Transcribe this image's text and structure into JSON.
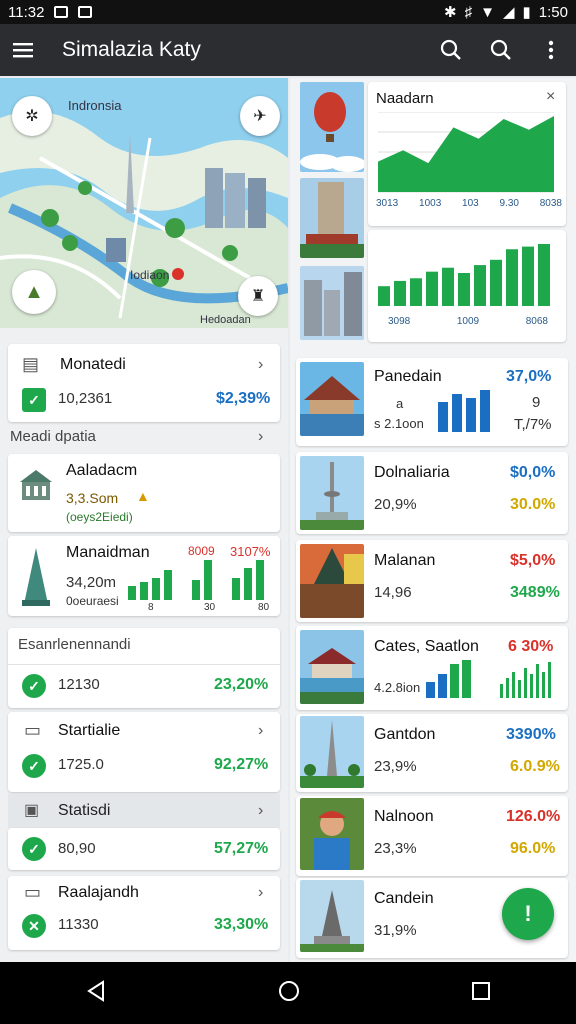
{
  "status": {
    "time": "11:32",
    "battery_time": "1:50"
  },
  "app": {
    "title": "Simalazia Katy"
  },
  "map": {
    "label": "Indronsia",
    "label2": "Iodiaon",
    "label3": "Hedoadan"
  },
  "left": {
    "card1": {
      "name": "Monatedi",
      "value": "10,2361",
      "pct": "$2,39%"
    },
    "section1": "Meadi dpatia",
    "card2": {
      "name": "Aaladacm",
      "value": "3,3.Som",
      "sub": "(oeys2Eiedi)"
    },
    "card3": {
      "name": "Manaidman",
      "value": "34,20m",
      "sub": "0oeuraesi",
      "pct1": "8009",
      "pct2": "3107%",
      "ticks": [
        "8",
        "30",
        "80"
      ]
    },
    "section2": "Esanrlenennandi",
    "row1": {
      "value": "12130",
      "pct": "23,20%"
    },
    "row2": {
      "name": "Startialie",
      "value": "1725.0",
      "pct": "92,27%"
    },
    "row3": {
      "name": "Statisdi",
      "value": "80,90",
      "pct": "57,27%"
    },
    "row4": {
      "name": "Raalajandh",
      "value": "11330",
      "pct": "33,30%"
    }
  },
  "right": {
    "chart1": {
      "title": "Naadarn",
      "ticks": [
        "3013",
        "1003",
        "103",
        "9.30",
        "8038"
      ],
      "values": [
        40,
        55,
        38,
        85,
        70,
        96,
        82,
        100
      ]
    },
    "chart2": {
      "ticks": [
        "3098",
        "1009",
        "8068"
      ],
      "values": [
        30,
        38,
        42,
        52,
        58,
        50,
        62,
        70,
        86,
        90,
        94
      ]
    },
    "item1": {
      "name": "Panedain",
      "left_small": "a",
      "left_red": "s 2.1oon",
      "pct": "37,0%",
      "val2": "9",
      "val3": "T,/7%"
    },
    "item2": {
      "name": "Dolnaliaria",
      "value": "20,9%",
      "pct": "$0,0%",
      "pct2": "30.0%"
    },
    "item3": {
      "name": "Malanan",
      "value": "14,96",
      "pct": "$5,0%",
      "pct2": "3489%"
    },
    "item4": {
      "name": "Cates, Saatlon",
      "value": "4.2.8ion",
      "pct": "6 30%"
    },
    "item5": {
      "name": "Gantdon",
      "value": "23,9%",
      "pct": "3390%",
      "pct2": "6.0.9%"
    },
    "item6": {
      "name": "Nalnoon",
      "value": "23,3%",
      "pct": "126.0%",
      "pct2": "96.0%"
    },
    "item7": {
      "name": "Candein",
      "value": "31,9%"
    }
  },
  "colors": {
    "accent": "#1ea84b",
    "blue": "#1b6fc2",
    "red": "#d8322b",
    "appbar": "#2b2d31"
  }
}
